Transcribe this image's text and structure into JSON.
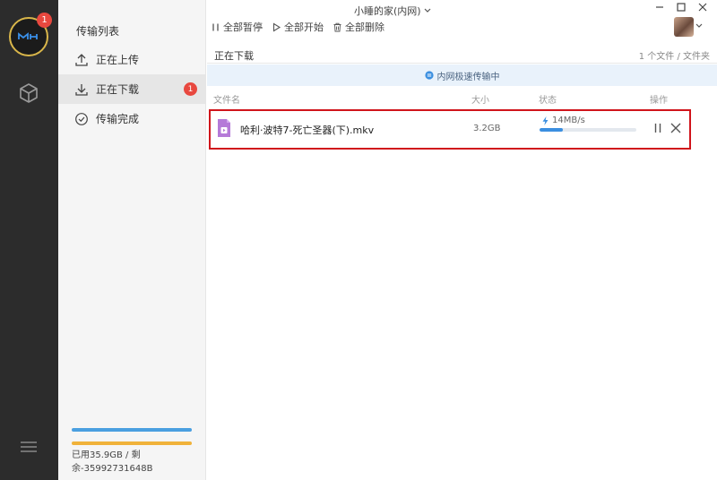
{
  "window": {
    "title": "小睡的家(内网)"
  },
  "rail": {
    "logo_badge": "1"
  },
  "sidebar": {
    "title": "传输列表",
    "items": [
      {
        "label": "正在上传",
        "icon": "upload-icon"
      },
      {
        "label": "正在下载",
        "icon": "download-icon",
        "badge": "1"
      },
      {
        "label": "传输完成",
        "icon": "check-circle-icon"
      }
    ],
    "storage": {
      "used_label": "已用35.9GB / 剩",
      "remaining_label": "余-35992731648B"
    }
  },
  "toolbar": {
    "pause_all": "全部暂停",
    "start_all": "全部开始",
    "delete_all": "全部删除"
  },
  "section": {
    "title": "正在下载",
    "count": "1 个文件 / 文件夹"
  },
  "banner": {
    "text": "内网极速传输中"
  },
  "columns": {
    "name": "文件名",
    "size": "大小",
    "status": "状态",
    "actions": "操作"
  },
  "files": [
    {
      "name": "哈利·波特7-死亡圣器(下).mkv",
      "size": "3.2GB",
      "speed": "14MB/s",
      "progress": 0.24
    }
  ],
  "colors": {
    "accent": "#3b8fe0",
    "badge": "#e8483f",
    "highlight": "#d0141b",
    "storage_used": "#4a9fe0",
    "storage_free": "#f0b23a"
  }
}
